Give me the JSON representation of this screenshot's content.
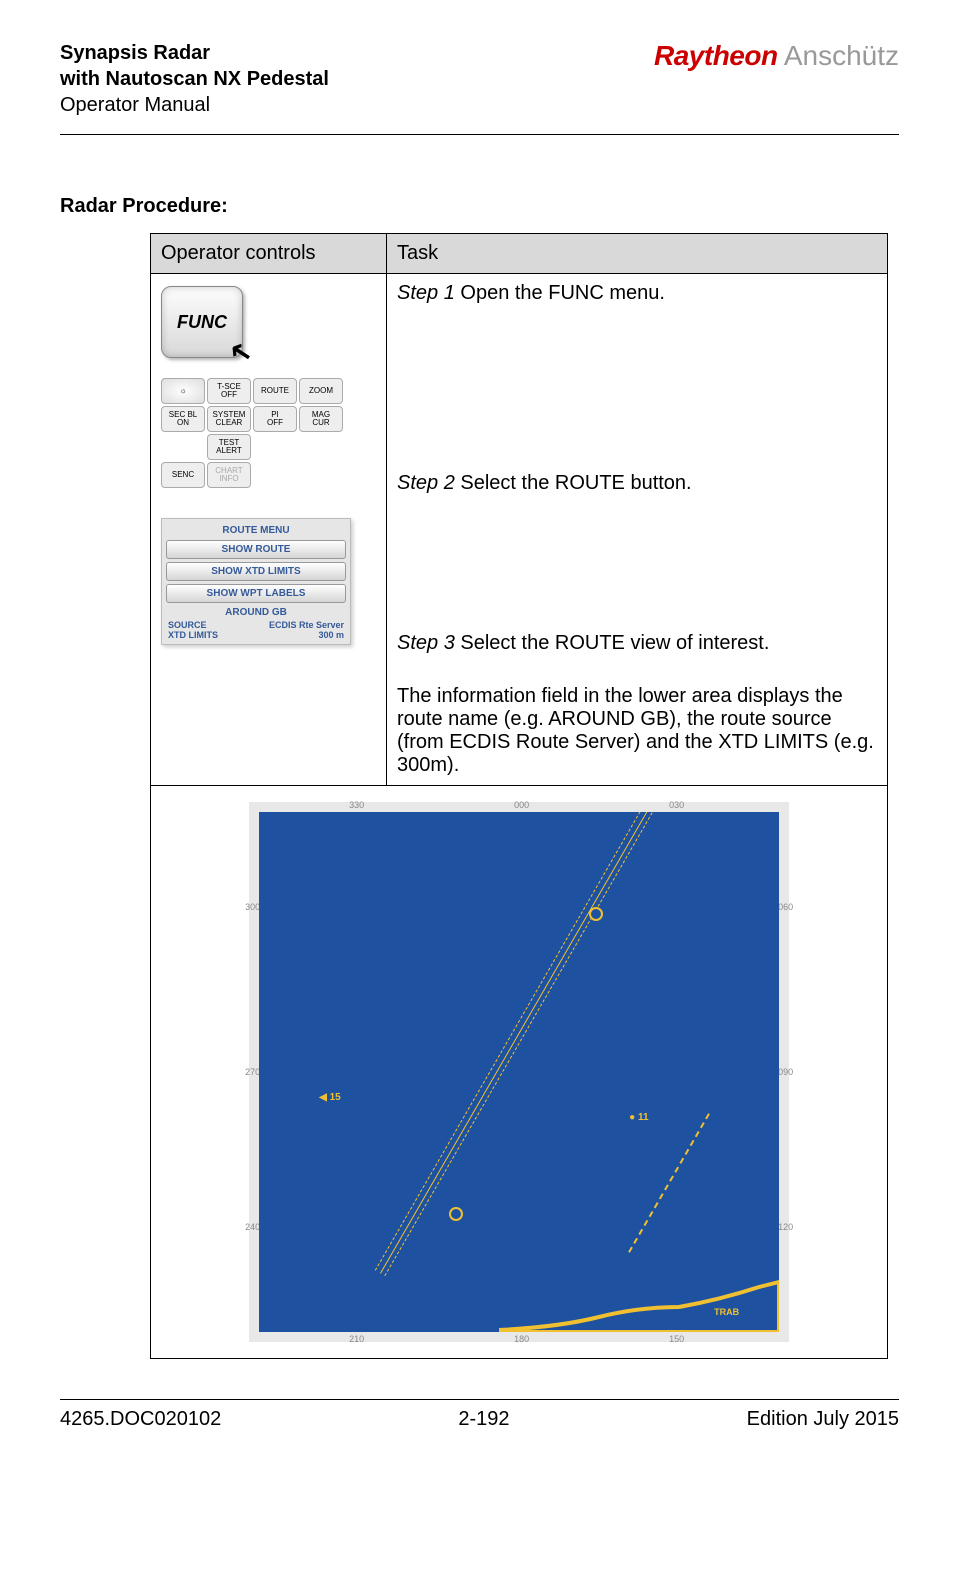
{
  "header": {
    "title1": "Synapsis Radar",
    "title2": "with Nautoscan NX Pedestal",
    "subtitle": "Operator Manual",
    "brand_primary": "Raytheon",
    "brand_secondary": "Anschütz"
  },
  "section_title": "Radar Procedure:",
  "table": {
    "col1_header": "Operator controls",
    "col2_header": "Task"
  },
  "controls": {
    "func_label": "FUNC",
    "grid": {
      "b1": "",
      "b2": "T-SCE\nOFF",
      "b3": "ROUTE",
      "b4": "ZOOM",
      "b5": "SEC BL\nON",
      "b6": "SYSTEM\nCLEAR",
      "b7": "PI\nOFF",
      "b8": "MAG\nCUR",
      "b9": "TEST\nALERT",
      "b10": "SENC",
      "b11": "CHART\nINFO"
    },
    "route_menu": {
      "title": "ROUTE MENU",
      "btn1": "SHOW ROUTE",
      "btn2": "SHOW XTD LIMITS",
      "btn3": "SHOW WPT LABELS",
      "name": "AROUND GB",
      "source_k": "SOURCE",
      "source_v": "ECDIS Rte Server",
      "xtd_k": "XTD LIMITS",
      "xtd_v": "300  m"
    }
  },
  "steps": {
    "s1_label": "Step 1",
    "s1_text": " Open the FUNC menu.",
    "s2_label": "Step 2",
    "s2_text": " Select the ROUTE button.",
    "s3_label": "Step 3",
    "s3_text": " Select the ROUTE view of interest.",
    "info_text": "The information field in the lower area displays the route name (e.g. AROUND GB), the route source (from ECDIS Route Server) and the XTD LIMITS (e.g. 300m)."
  },
  "radar_ticks": {
    "top1": "330",
    "top2": "000",
    "top3": "030",
    "left1": "300",
    "left2": "270",
    "left3": "240",
    "right1": "060",
    "right2": "090",
    "right3": "120",
    "bot1": "210",
    "bot2": "180",
    "bot3": "150",
    "label_trab": "TRAB"
  },
  "footer": {
    "doc": "4265.DOC020102",
    "page": "2-192",
    "edition": "Edition July 2015"
  }
}
